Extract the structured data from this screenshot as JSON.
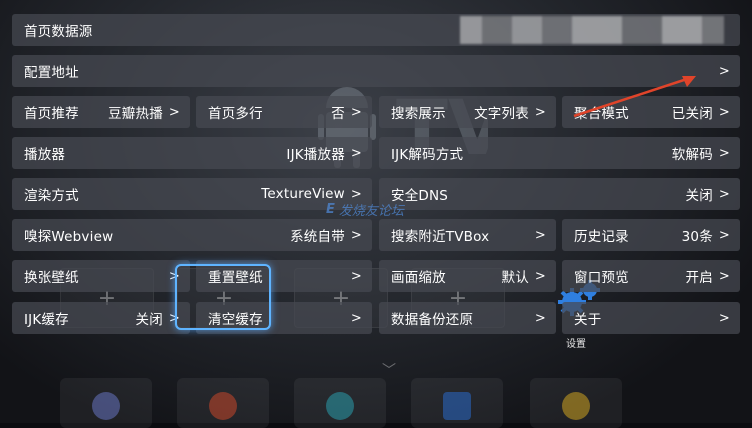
{
  "background": {
    "logo_text": "TV",
    "bottom_label": "设置"
  },
  "watermark": "发烧友论坛",
  "rows": {
    "data_source": {
      "label": "首页数据源",
      "value": ""
    },
    "config_url": {
      "label": "配置地址",
      "arrow": ">"
    },
    "home_recommend": {
      "label": "首页推荐",
      "value": "豆瓣热播",
      "arrow": ">"
    },
    "home_multirow": {
      "label": "首页多行",
      "value": "否",
      "arrow": ">"
    },
    "search_display": {
      "label": "搜索展示",
      "value": "文字列表",
      "arrow": ">"
    },
    "aggregate_mode": {
      "label": "聚合模式",
      "value": "已关闭",
      "arrow": ">"
    },
    "player": {
      "label": "播放器",
      "value": "IJK播放器",
      "arrow": ">"
    },
    "ijk_decode": {
      "label": "IJK解码方式",
      "value": "软解码",
      "arrow": ">"
    },
    "render": {
      "label": "渲染方式",
      "value": "TextureView",
      "arrow": ">"
    },
    "secure_dns": {
      "label": "安全DNS",
      "value": "关闭",
      "arrow": ">"
    },
    "sniff_webview": {
      "label": "嗅探Webview",
      "value": "系统自带",
      "arrow": ">"
    },
    "search_nearby": {
      "label": "搜索附近TVBox",
      "arrow": ">"
    },
    "history": {
      "label": "历史记录",
      "value": "30条",
      "arrow": ">"
    },
    "change_wallpaper": {
      "label": "换张壁纸",
      "arrow": ">"
    },
    "reset_wallpaper": {
      "label": "重置壁纸",
      "arrow": ">"
    },
    "picture_scale": {
      "label": "画面缩放",
      "value": "默认",
      "arrow": ">"
    },
    "window_preview": {
      "label": "窗口预览",
      "value": "开启",
      "arrow": ">"
    },
    "ijk_cache": {
      "label": "IJK缓存",
      "value": "关闭",
      "arrow": ">"
    },
    "clear_cache": {
      "label": "清空缓存",
      "arrow": ">"
    },
    "backup_restore": {
      "label": "数据备份还原",
      "arrow": ">"
    },
    "about": {
      "label": "关于",
      "arrow": ">"
    }
  },
  "colors": {
    "focus": "#5fb4ff",
    "annotation_arrow": "#e0442a"
  }
}
